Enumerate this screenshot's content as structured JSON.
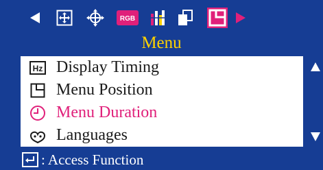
{
  "osd": {
    "title": "Menu",
    "colors": {
      "background": "#163D94",
      "title": "#FFD200",
      "active_item": "#E0207A",
      "panel": "#FFFFFF",
      "highlight_tab": "#E0207A"
    },
    "tabs": [
      {
        "icon": "arrow-left-icon"
      },
      {
        "icon": "position-icon"
      },
      {
        "icon": "geometry-icon"
      },
      {
        "icon": "rgb-icon",
        "label": "RGB"
      },
      {
        "icon": "color-bars-icon"
      },
      {
        "icon": "windows-icon"
      },
      {
        "icon": "menu-setup-icon",
        "selected": true
      },
      {
        "icon": "arrow-right-icon"
      }
    ],
    "items": [
      {
        "label": "Display Timing",
        "icon": "hz-icon",
        "icon_text": "Hz"
      },
      {
        "label": "Menu Position",
        "icon": "menu-position-icon"
      },
      {
        "label": "Menu Duration",
        "icon": "clock-icon",
        "active": true
      },
      {
        "label": "Languages",
        "icon": "languages-icon"
      }
    ],
    "footer": {
      "icon": "enter-icon",
      "text": ": Access Function"
    }
  }
}
